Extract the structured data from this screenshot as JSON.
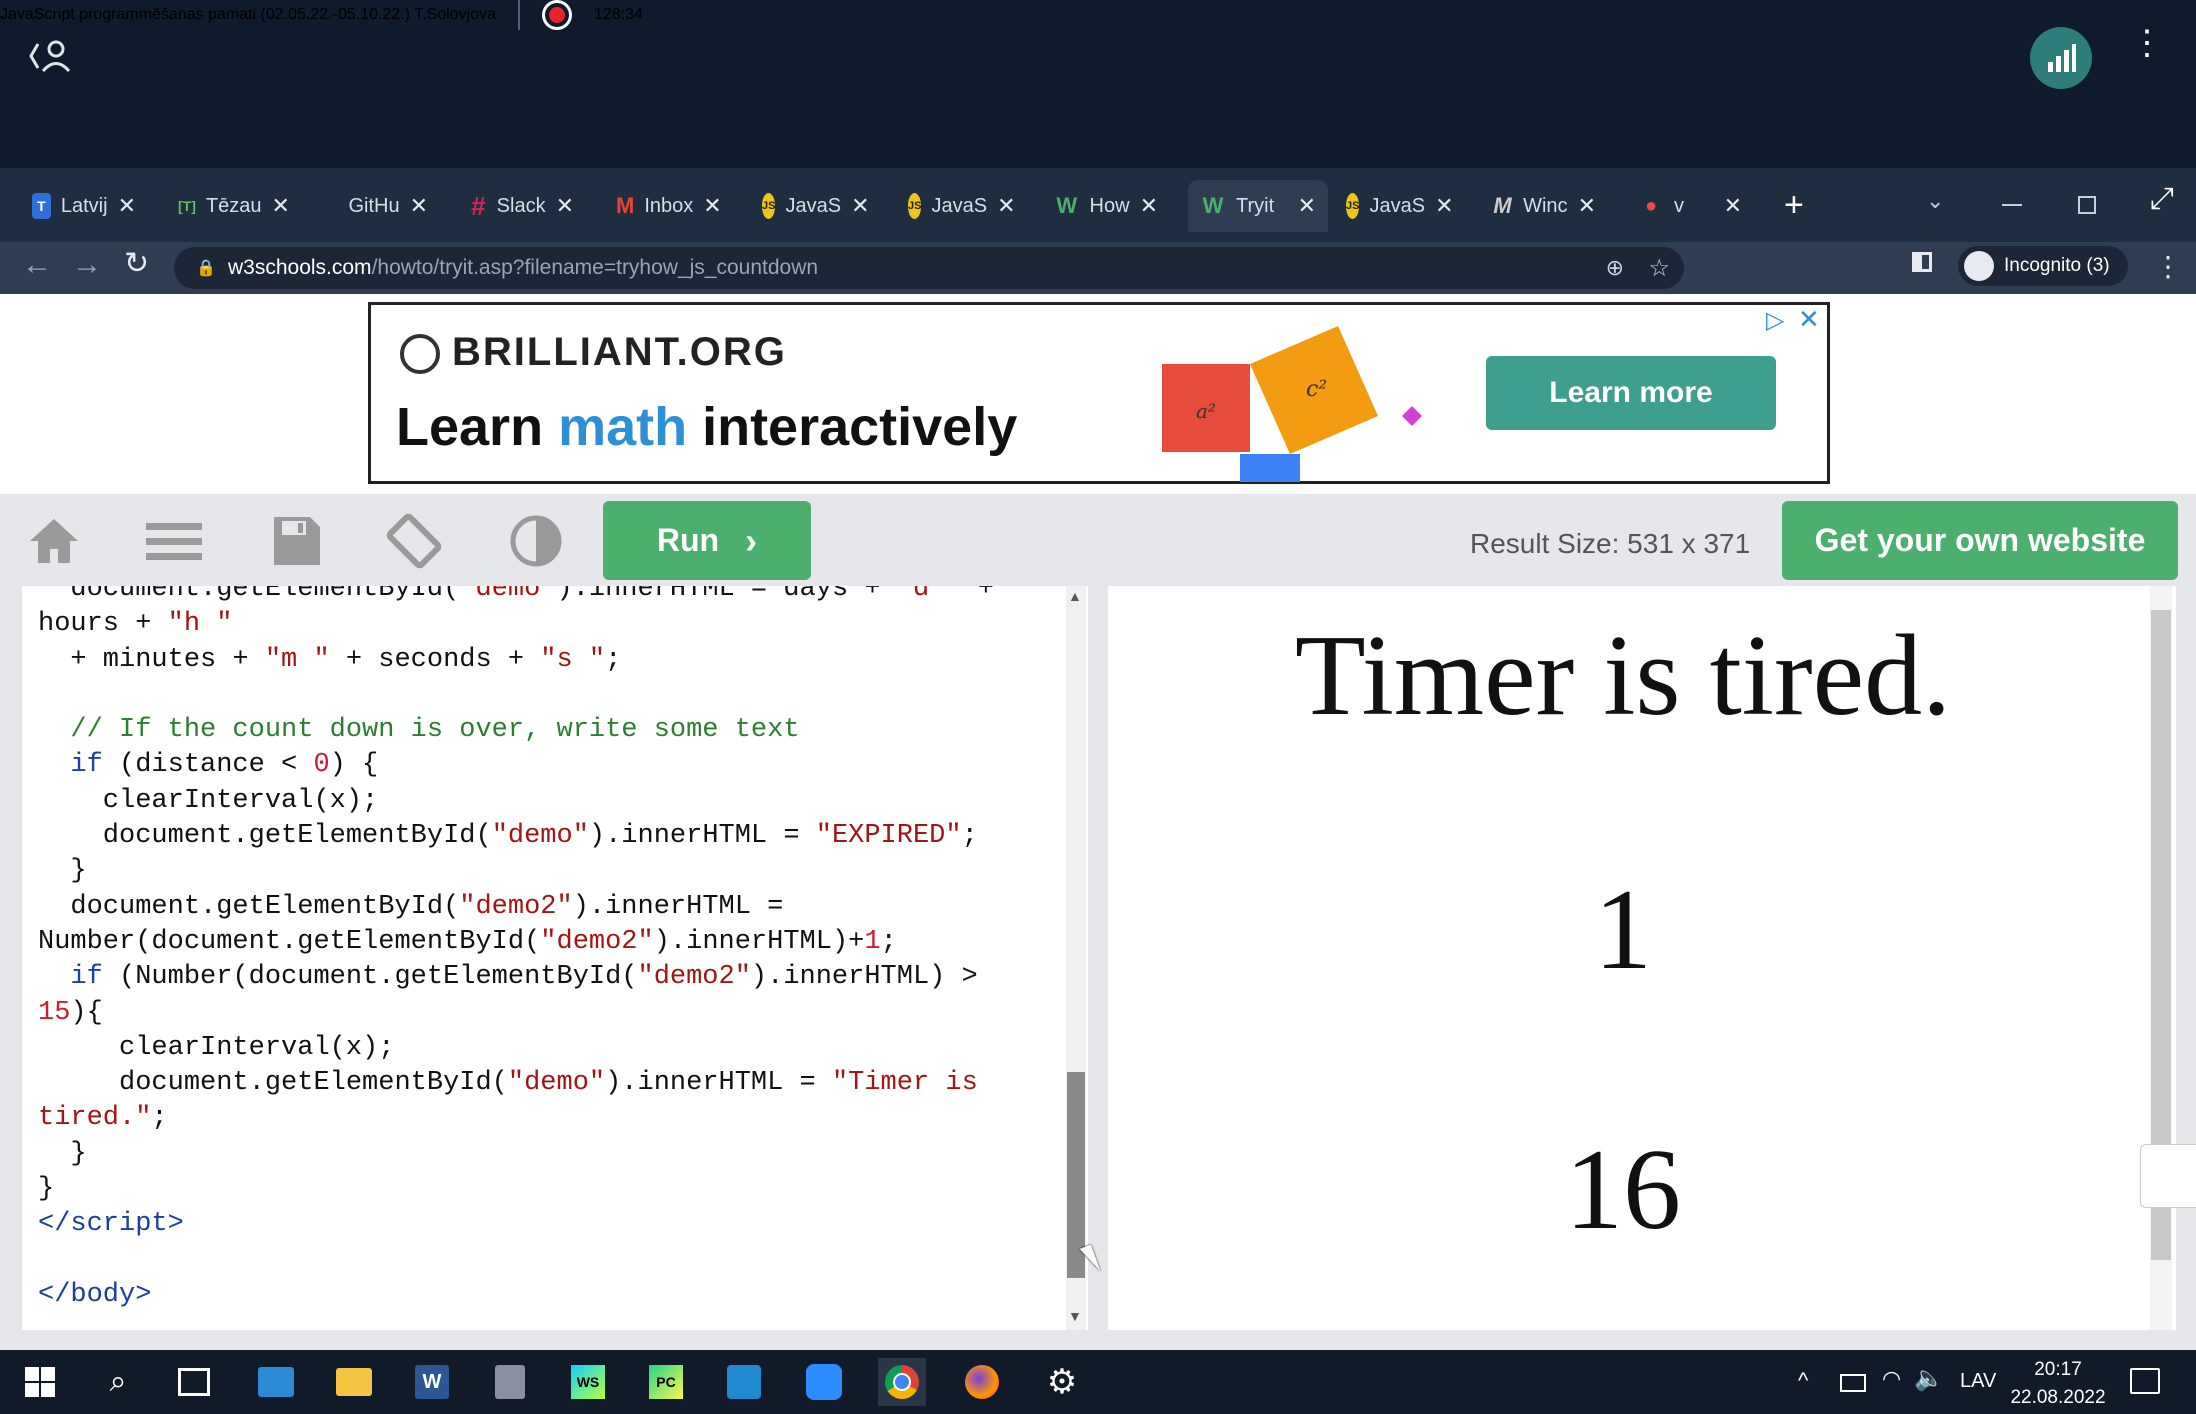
{
  "meeting": {
    "title": "JavaScript programmēšanas pamati (02.05.22.-05.10.22.) T.Solovjova",
    "timer": "128:34"
  },
  "tabs": [
    {
      "label": "Latvij",
      "favicon": "T",
      "color": "#2f6fd8"
    },
    {
      "label": "Tēzau",
      "favicon": "[T]",
      "color": "#3c8a3c"
    },
    {
      "label": "GitHu",
      "favicon": "",
      "color": "#1f2d40"
    },
    {
      "label": "Slack",
      "favicon": "#",
      "color": "#7a2e7f"
    },
    {
      "label": "Inbox",
      "favicon": "M",
      "color": "#d93025"
    },
    {
      "label": "JavaS",
      "favicon": "JS",
      "color": "#f0c419"
    },
    {
      "label": "JavaS",
      "favicon": "JS",
      "color": "#f0c419"
    },
    {
      "label": "How",
      "favicon": "W",
      "color": "#4caf6e"
    },
    {
      "label": "Tryit",
      "favicon": "W",
      "color": "#4caf6e"
    },
    {
      "label": "JavaS",
      "favicon": "JS",
      "color": "#f0c419"
    },
    {
      "label": "Winc",
      "favicon": "M",
      "color": "#333"
    },
    {
      "label": "v",
      "favicon": "●",
      "color": "#c0392b"
    }
  ],
  "address": {
    "domain": "w3schools.com",
    "path": "/howto/tryit.asp?filename=tryhow_js_countdown",
    "profile": "Incognito (3)"
  },
  "ad": {
    "brand": "BRILLIANT.ORG",
    "headline_a": "Learn ",
    "headline_b": "math",
    "headline_c": " interactively",
    "cta": "Learn more"
  },
  "toolbar": {
    "run_label": "Run",
    "result_size": "Result Size: 531 x 371",
    "get_website": "Get your own website"
  },
  "result": {
    "line1": "Timer is tired.",
    "line2": "1",
    "line3": "16"
  },
  "taskbar": {
    "lang": "LAV",
    "time": "20:17",
    "date": "22.08.2022"
  }
}
